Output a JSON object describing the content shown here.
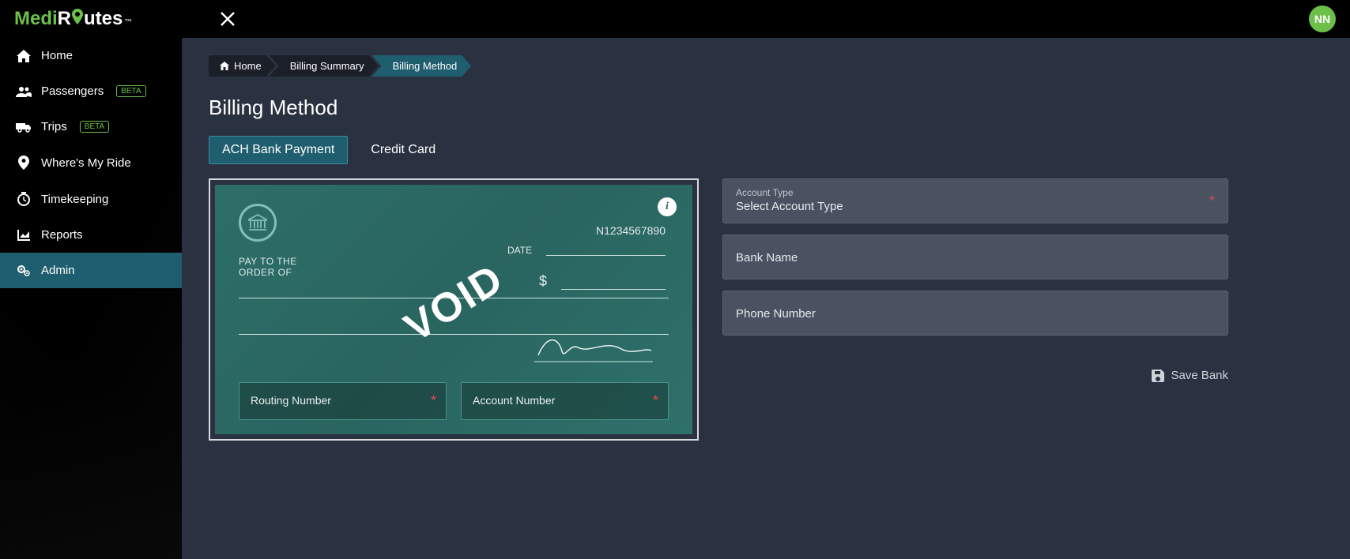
{
  "brand": {
    "part1": "Medi",
    "part2": "R",
    "part3": "utes",
    "tm": "™"
  },
  "avatar_initials": "NN",
  "sidebar": {
    "items": [
      {
        "label": "Home",
        "beta": false
      },
      {
        "label": "Passengers",
        "beta": true
      },
      {
        "label": "Trips",
        "beta": true
      },
      {
        "label": "Where's My Ride",
        "beta": false
      },
      {
        "label": "Timekeeping",
        "beta": false
      },
      {
        "label": "Reports",
        "beta": false
      },
      {
        "label": "Admin",
        "beta": false
      }
    ],
    "beta_text": "BETA"
  },
  "breadcrumb": {
    "home": "Home",
    "summary": "Billing Summary",
    "method": "Billing Method"
  },
  "page_title": "Billing Method",
  "tabs": {
    "ach": "ACH Bank Payment",
    "cc": "Credit Card"
  },
  "check": {
    "serial": "N1234567890",
    "payto1": "PAY TO THE",
    "payto2": "ORDER OF",
    "date_label": "DATE",
    "dollar": "$",
    "void": "VOID",
    "routing_label": "Routing Number",
    "account_label": "Account Number"
  },
  "form": {
    "account_type_label": "Account Type",
    "account_type_value": "Select Account Type",
    "bank_name_label": "Bank Name",
    "phone_label": "Phone Number"
  },
  "buttons": {
    "save": "Save Bank"
  },
  "required_marker": "*"
}
